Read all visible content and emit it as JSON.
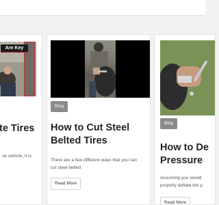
{
  "cards": [
    {
      "thumb_caption": "Are Key",
      "title": "te Tires",
      "excerpt": "ve vehicle, it is"
    },
    {
      "category": "Blog",
      "title_line1": "How to Cut Steel",
      "title_line2": "Belted Tires",
      "excerpt_line1": "There are a few different ways that you can",
      "excerpt_line2": "cut steel belted",
      "read_more": "Read More"
    },
    {
      "category": "Blog",
      "title_line1": "How to De",
      "title_line2": "Pressure",
      "excerpt_line1": "Assuming you would",
      "excerpt_line2": "properly deflate tire p",
      "read_more": "Read More"
    }
  ],
  "colors": {
    "badge": "#8a8a8a",
    "banner_accent": "#c0282e"
  }
}
